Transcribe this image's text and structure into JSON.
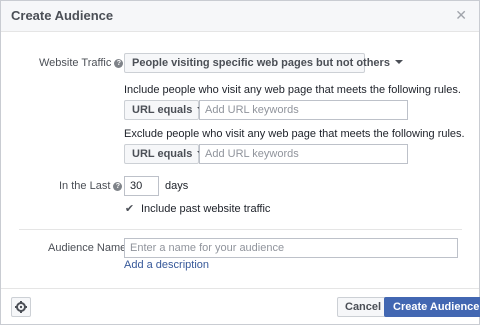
{
  "header": {
    "title": "Create Audience",
    "close_icon": "close-icon"
  },
  "website_traffic": {
    "label": "Website Traffic",
    "info_glyph": "?",
    "dropdown_value": "People visiting specific web pages but not others"
  },
  "include": {
    "description": "Include people who visit any web page that meets the following rules.",
    "condition": "URL equals",
    "placeholder": "Add URL keywords"
  },
  "exclude": {
    "description": "Exclude people who visit any web page that meets the following rules.",
    "condition": "URL equals",
    "placeholder": "Add URL keywords"
  },
  "in_the_last": {
    "label": "In the Last",
    "info_glyph": "?",
    "value": "30",
    "unit": "days"
  },
  "past_traffic": {
    "label": "Include past website traffic",
    "checked": true
  },
  "audience_name": {
    "label": "Audience Name",
    "placeholder": "Enter a name for your audience",
    "add_description_link": "Add a description"
  },
  "footer": {
    "settings_icon": "gear-icon",
    "cancel_label": "Cancel",
    "create_label": "Create Audience"
  }
}
